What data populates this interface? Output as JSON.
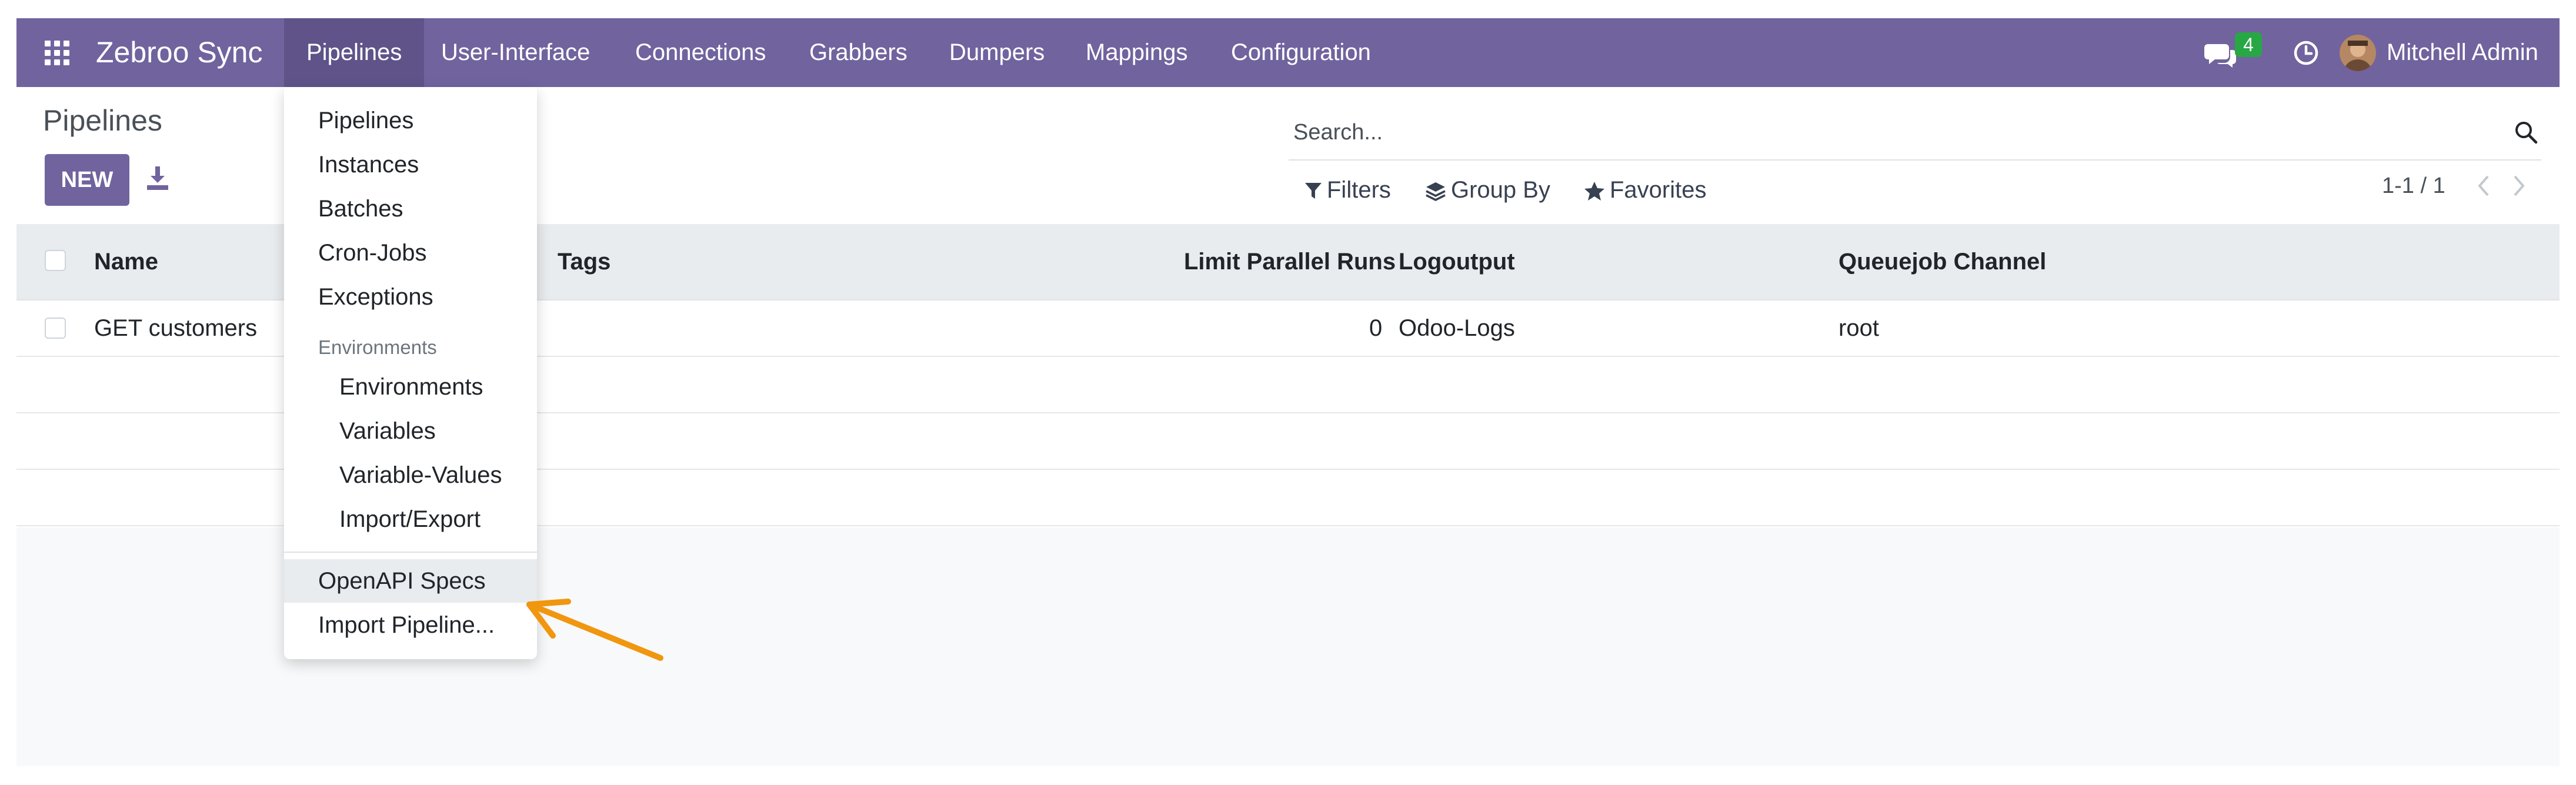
{
  "navbar": {
    "brand": "Zebroo Sync",
    "menus": [
      "Pipelines",
      "User-Interface",
      "Connections",
      "Grabbers",
      "Dumpers",
      "Mappings",
      "Configuration"
    ],
    "message_count": "4",
    "user_name": "Mitchell Admin"
  },
  "control_panel": {
    "title": "Pipelines",
    "new_label": "NEW",
    "search_placeholder": "Search...",
    "filters_label": "Filters",
    "group_by_label": "Group By",
    "favorites_label": "Favorites",
    "pager": "1-1 / 1"
  },
  "table": {
    "columns": [
      "Name",
      "Tags",
      "Limit Parallel Runs",
      "Logoutput",
      "Queuejob Channel"
    ],
    "rows": [
      {
        "name": "GET customers",
        "tags": "",
        "limit_parallel_runs": "0",
        "logoutput": "Odoo-Logs",
        "queuejob_channel": "root"
      }
    ]
  },
  "dropdown": {
    "items": [
      "Pipelines",
      "Instances",
      "Batches",
      "Cron-Jobs",
      "Exceptions"
    ],
    "section_header": "Environments",
    "sub_items": [
      "Environments",
      "Variables",
      "Variable-Values",
      "Import/Export"
    ],
    "bottom_items": [
      "OpenAPI Specs",
      "Import Pipeline..."
    ]
  },
  "colors": {
    "brand": "#71639e",
    "active_menu": "#5f5389",
    "badge": "#28a745",
    "annotation_arrow": "#f0960f"
  }
}
